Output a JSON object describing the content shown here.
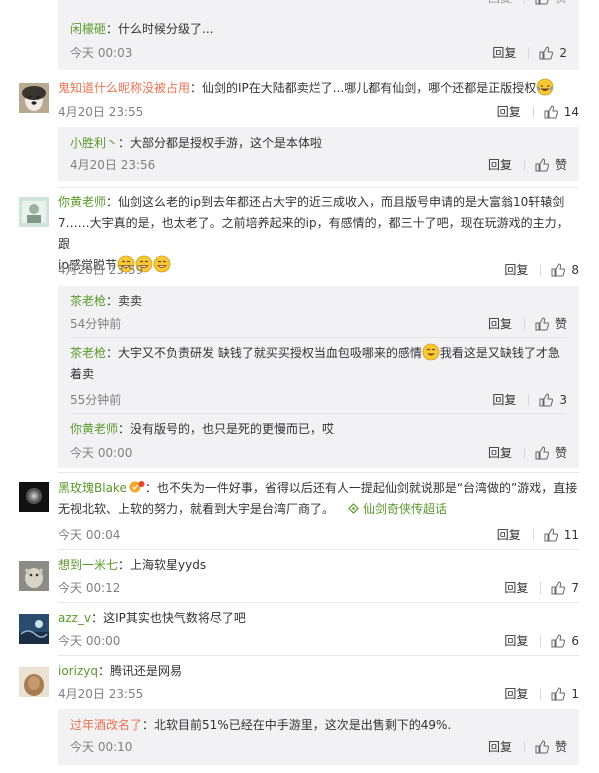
{
  "labels": {
    "reply": "回复",
    "like_word": "赞"
  },
  "comments": [
    {
      "replies": [
        {
          "user": "闲檬砸",
          "text": "：什么时候分级了...",
          "time": "今天 00:03",
          "likes": "2"
        }
      ]
    },
    {
      "user": "鬼知道什么昵称没被占用",
      "text": "：仙剑的IP在大陆都卖烂了...哪儿都有仙剑，哪个还都是正版授权",
      "time": "4月20日 23:55",
      "likes": "14",
      "replies": [
        {
          "user": "小胜利丶",
          "text": "：大部分都是授权手游，这个是本体啦",
          "time": "4月20日 23:56",
          "likes": "赞"
        }
      ]
    },
    {
      "user": "你黄老师",
      "text_1": "：仙剑这么老的ip到去年都还占大宇的近三成收入，而且版号申请的是大富翁10轩辕剑",
      "text_2": "7……大宇真的是，也太老了。之前培养起来的ip，有感情的，都三十了吧，现在玩游戏的主力，跟",
      "text_3": "ip感觉脱节",
      "time": "4月20日 23:59",
      "likes": "8",
      "replies": [
        {
          "user": "茶老枪",
          "text": "：卖卖",
          "time": "54分钟前",
          "likes": "赞"
        },
        {
          "user": "茶老枪",
          "text_1": "：大宇又不负责研发 缺钱了就买买授权当血包吸哪来的感情",
          "text_1b": "我看这是又缺钱了才急",
          "text_2": "着卖",
          "time": "55分钟前",
          "likes": "3"
        },
        {
          "user": "你黄老师",
          "text": "：没有版号的，也只是死的更慢而已，哎",
          "time": "今天 00:00",
          "likes": "赞"
        }
      ]
    },
    {
      "user": "黑玫瑰Blake",
      "text_1": "：也不失为一件好事，省得以后还有人一提起仙剑就说那是“台湾做的”游戏，直接",
      "text_2": "无视北软、上软的努力，就看到大宇是台湾厂商了。",
      "topic": "仙剑奇侠传超话",
      "time": "今天 00:04",
      "likes": "11"
    },
    {
      "user": "想到一米七",
      "text": "：上海软星yyds",
      "time": "今天 00:12",
      "likes": "7"
    },
    {
      "user": "azz_v",
      "text": "：这IP其实也快气数将尽了吧",
      "time": "今天 00:00",
      "likes": "6"
    },
    {
      "user": "iorizyq",
      "text": "：腾讯还是网易",
      "time": "4月20日 23:55",
      "likes": "1",
      "replies": [
        {
          "user": "过年酒改名了",
          "text": "：北软目前51%已经在中手游里，这次是出售剩下的49%.",
          "time": "今天 00:10",
          "likes": "赞"
        }
      ]
    }
  ],
  "colors": {
    "username": "#eb7350",
    "topic": "#5a9a2d",
    "reply_bg": "#f2f2f5",
    "meta": "#808080"
  },
  "icons": [
    "thumbs-up-icon",
    "laughing-emoji-icon",
    "grin-emoji-icon",
    "badge-icon",
    "topic-diamond-icon"
  ]
}
